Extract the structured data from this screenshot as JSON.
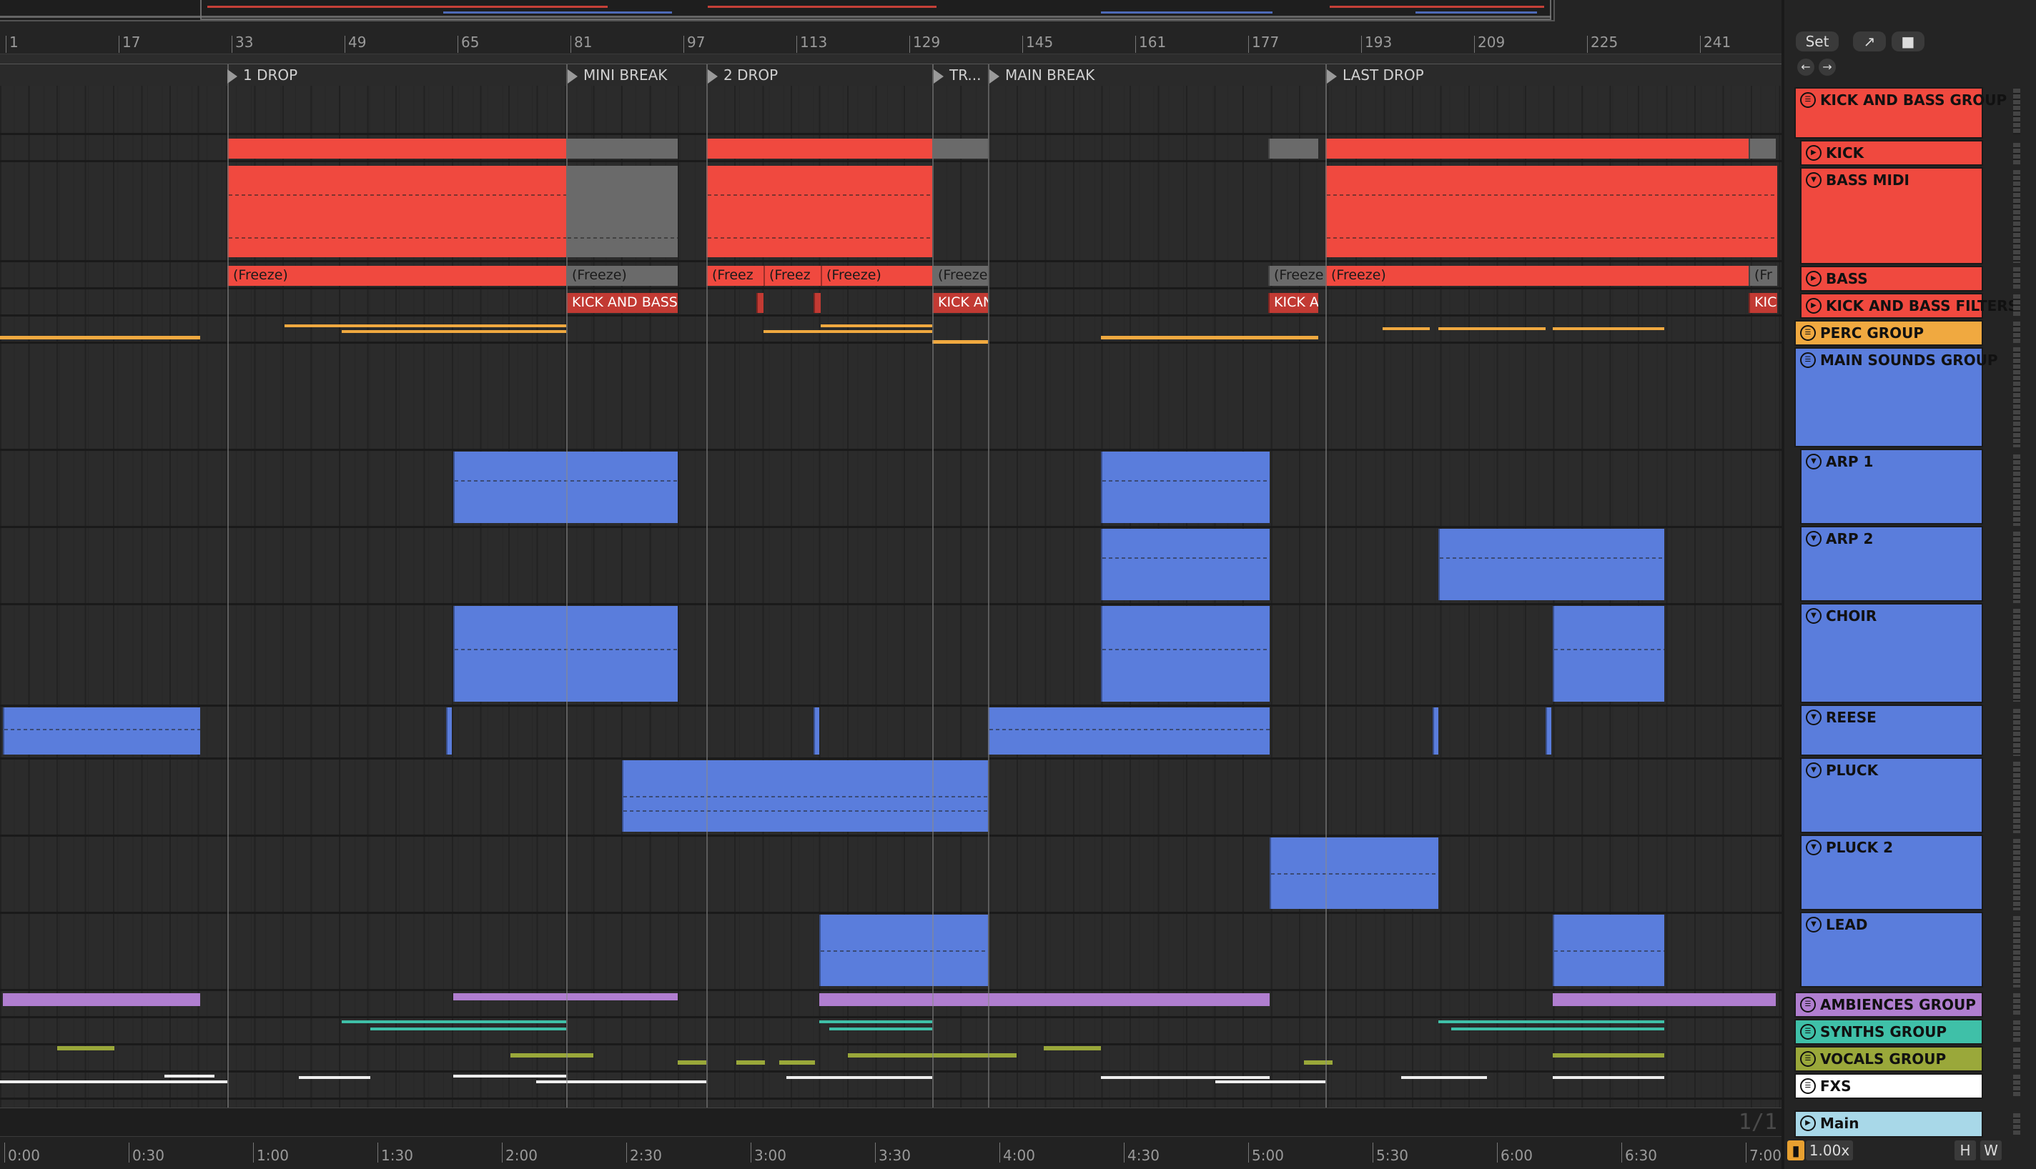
{
  "ruler_bars": [
    "1",
    "17",
    "33",
    "49",
    "65",
    "81",
    "97",
    "113",
    "129",
    "145",
    "161",
    "177",
    "193",
    "209",
    "225",
    "241"
  ],
  "locators": [
    "1 DROP",
    "MINI BREAK",
    "2 DROP",
    "TR...",
    "MAIN BREAK",
    "LAST DROP"
  ],
  "freeze_label": "(Freeze)",
  "freeze_short": [
    "(Freez",
    "(Freez",
    "(Freeze",
    "(Freeze",
    "(Fr"
  ],
  "kb_labels": [
    "KICK AND BASS",
    "KICK AN",
    "KICK A",
    "KIC"
  ],
  "clip_count": "1/1",
  "time_ticks": [
    "0:00",
    "0:30",
    "1:00",
    "1:30",
    "2:00",
    "2:30",
    "3:00",
    "3:30",
    "4:00",
    "4:30",
    "5:00",
    "5:30",
    "6:00",
    "6:30",
    "7:00"
  ],
  "panel": {
    "set_label": "Set",
    "tracks": [
      {
        "name": "KICK AND BASS GROUP",
        "color": "#f0493f",
        "kind": "group"
      },
      {
        "name": "KICK",
        "color": "#f0493f",
        "kind": "audio"
      },
      {
        "name": "BASS MIDI",
        "color": "#f0493f",
        "kind": "midi"
      },
      {
        "name": "BASS",
        "color": "#f0493f",
        "kind": "audio"
      },
      {
        "name": "KICK AND BASS FILTERS",
        "color": "#f0493f",
        "kind": "audio"
      },
      {
        "name": "PERC GROUP",
        "color": "#f0a940",
        "kind": "group"
      },
      {
        "name": "MAIN SOUNDS GROUP",
        "color": "#5a7ddc",
        "kind": "group"
      },
      {
        "name": "ARP 1",
        "color": "#5a7ddc",
        "kind": "midi"
      },
      {
        "name": "ARP 2",
        "color": "#5a7ddc",
        "kind": "midi"
      },
      {
        "name": "CHOIR",
        "color": "#5a7ddc",
        "kind": "midi"
      },
      {
        "name": "REESE",
        "color": "#5a7ddc",
        "kind": "midi"
      },
      {
        "name": "PLUCK",
        "color": "#5a7ddc",
        "kind": "midi"
      },
      {
        "name": "PLUCK 2",
        "color": "#5a7ddc",
        "kind": "midi"
      },
      {
        "name": "LEAD",
        "color": "#5a7ddc",
        "kind": "midi"
      },
      {
        "name": "AMBIENCES GROUP",
        "color": "#b07ed0",
        "kind": "group"
      },
      {
        "name": "SYNTHS GROUP",
        "color": "#3fc0a8",
        "kind": "group"
      },
      {
        "name": "VOCALS GROUP",
        "color": "#9aa83a",
        "kind": "group"
      },
      {
        "name": "FXS",
        "color": "#ffffff",
        "kind": "group"
      },
      {
        "name": "Main",
        "color": "#a8d8e8",
        "kind": "audio"
      }
    ],
    "zoom": "1.00x",
    "h_label": "H",
    "w_label": "W"
  }
}
